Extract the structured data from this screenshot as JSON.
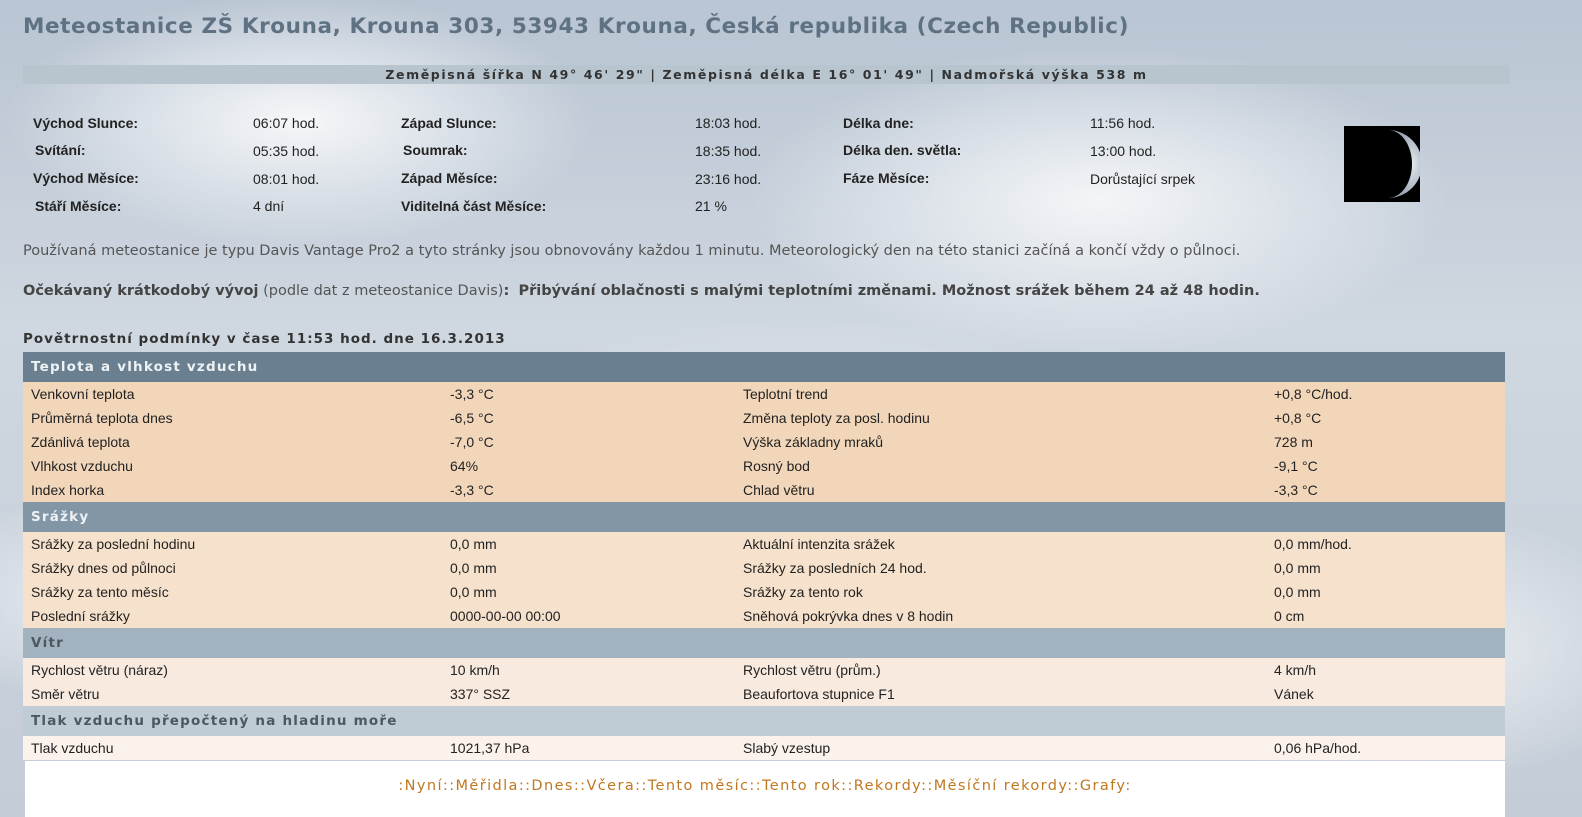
{
  "title": "Meteostanice ZŠ Krouna, Krouna 303, 53943 Krouna, Česká republika (Czech Republic)",
  "coords": "Zeměpisná šířka N 49° 46' 29\"  |  Zeměpisná délka E 16° 01' 49\"  |  Nadmořská výška 538 m",
  "astro": {
    "sunrise_label": "Východ Slunce:",
    "sunrise": "06:07 hod.",
    "sunset_label": "Západ Slunce:",
    "sunset": "18:03 hod.",
    "daylen_label": "Délka dne:",
    "daylen": "11:56 hod.",
    "dawn_label": "Svítání:",
    "dawn": "05:35 hod.",
    "dusk_label": "Soumrak:",
    "dusk": "18:35 hod.",
    "daylight_label": "Délka den. světla:",
    "daylight": "13:00 hod.",
    "moonrise_label": "Východ Měsíce:",
    "moonrise": "08:01 hod.",
    "moonset_label": "Západ Měsíce:",
    "moonset": "23:16 hod.",
    "phase_label": "Fáze Měsíce:",
    "phase": "Dorůstající srpek",
    "age_label": "Stáří Měsíce:",
    "age": "4 dní",
    "visible_label": "Viditelná část Měsíce:",
    "visible": "21 %"
  },
  "description": "Používaná meteostanice je typu Davis Vantage Pro2 a tyto stránky jsou obnovovány každou 1 minutu. Meteorologický den na této stanici začíná a končí vždy o půlnoci.",
  "forecast": {
    "label": "Očekávaný krátkodobý vývoj",
    "source": "(podle dat z meteostanice Davis)",
    "colon": ":",
    "text": "Přibývání oblačnosti s malými teplotními změnami. Možnost srážek během 24 až 48 hodin."
  },
  "conditions_title": "Povětrnostní podmínky v čase 11:53 hod. dne 16.3.2013",
  "sections": {
    "temp": {
      "title": "Teplota a vlhkost vzduchu",
      "rows": [
        [
          "Venkovní teplota",
          "-3,3 °C",
          "Teplotní trend",
          "+0,8 °C/hod."
        ],
        [
          "Průměrná teplota dnes",
          "-6,5 °C",
          "Změna teploty za posl. hodinu",
          "+0,8 °C"
        ],
        [
          "Zdánlivá teplota",
          "-7,0 °C",
          "Výška základny mraků",
          "728 m"
        ],
        [
          "Vlhkost vzduchu",
          "64%",
          "Rosný bod",
          "-9,1 °C"
        ],
        [
          "Index horka",
          "-3,3 °C",
          "Chlad větru",
          "-3,3 °C"
        ]
      ]
    },
    "rain": {
      "title": "Srážky",
      "rows": [
        [
          "Srážky za poslední hodinu",
          "0,0 mm",
          "Aktuální intenzita srážek",
          "0,0 mm/hod."
        ],
        [
          "Srážky dnes od půlnoci",
          "0,0 mm",
          "Srážky za posledních 24 hod.",
          "0,0 mm"
        ],
        [
          "Srážky za tento měsíc",
          "0,0 mm",
          "Srážky za tento rok",
          "0,0 mm"
        ],
        [
          "Poslední srážky",
          "0000-00-00 00:00",
          "Sněhová pokrývka dnes v 8 hodin",
          "0 cm"
        ]
      ]
    },
    "wind": {
      "title": "Vítr",
      "rows": [
        [
          "Rychlost větru (náraz)",
          "10 km/h",
          "Rychlost větru (prům.)",
          "4 km/h"
        ],
        [
          "Směr větru",
          "337° SSZ",
          "Beaufortova stupnice F1",
          "Vánek"
        ]
      ]
    },
    "pressure": {
      "title": "Tlak vzduchu přepočtený na hladinu moře",
      "rows": [
        [
          "Tlak vzduchu",
          "1021,37 hPa",
          "Slabý vzestup",
          "0,06 hPa/hod."
        ]
      ]
    }
  },
  "nav": [
    "Nyní",
    "Měřidla",
    "Dnes",
    "Včera",
    "Tento měsíc",
    "Tento rok",
    "Rekordy",
    "Měsíční rekordy",
    "Grafy"
  ],
  "nav_sep": ":"
}
